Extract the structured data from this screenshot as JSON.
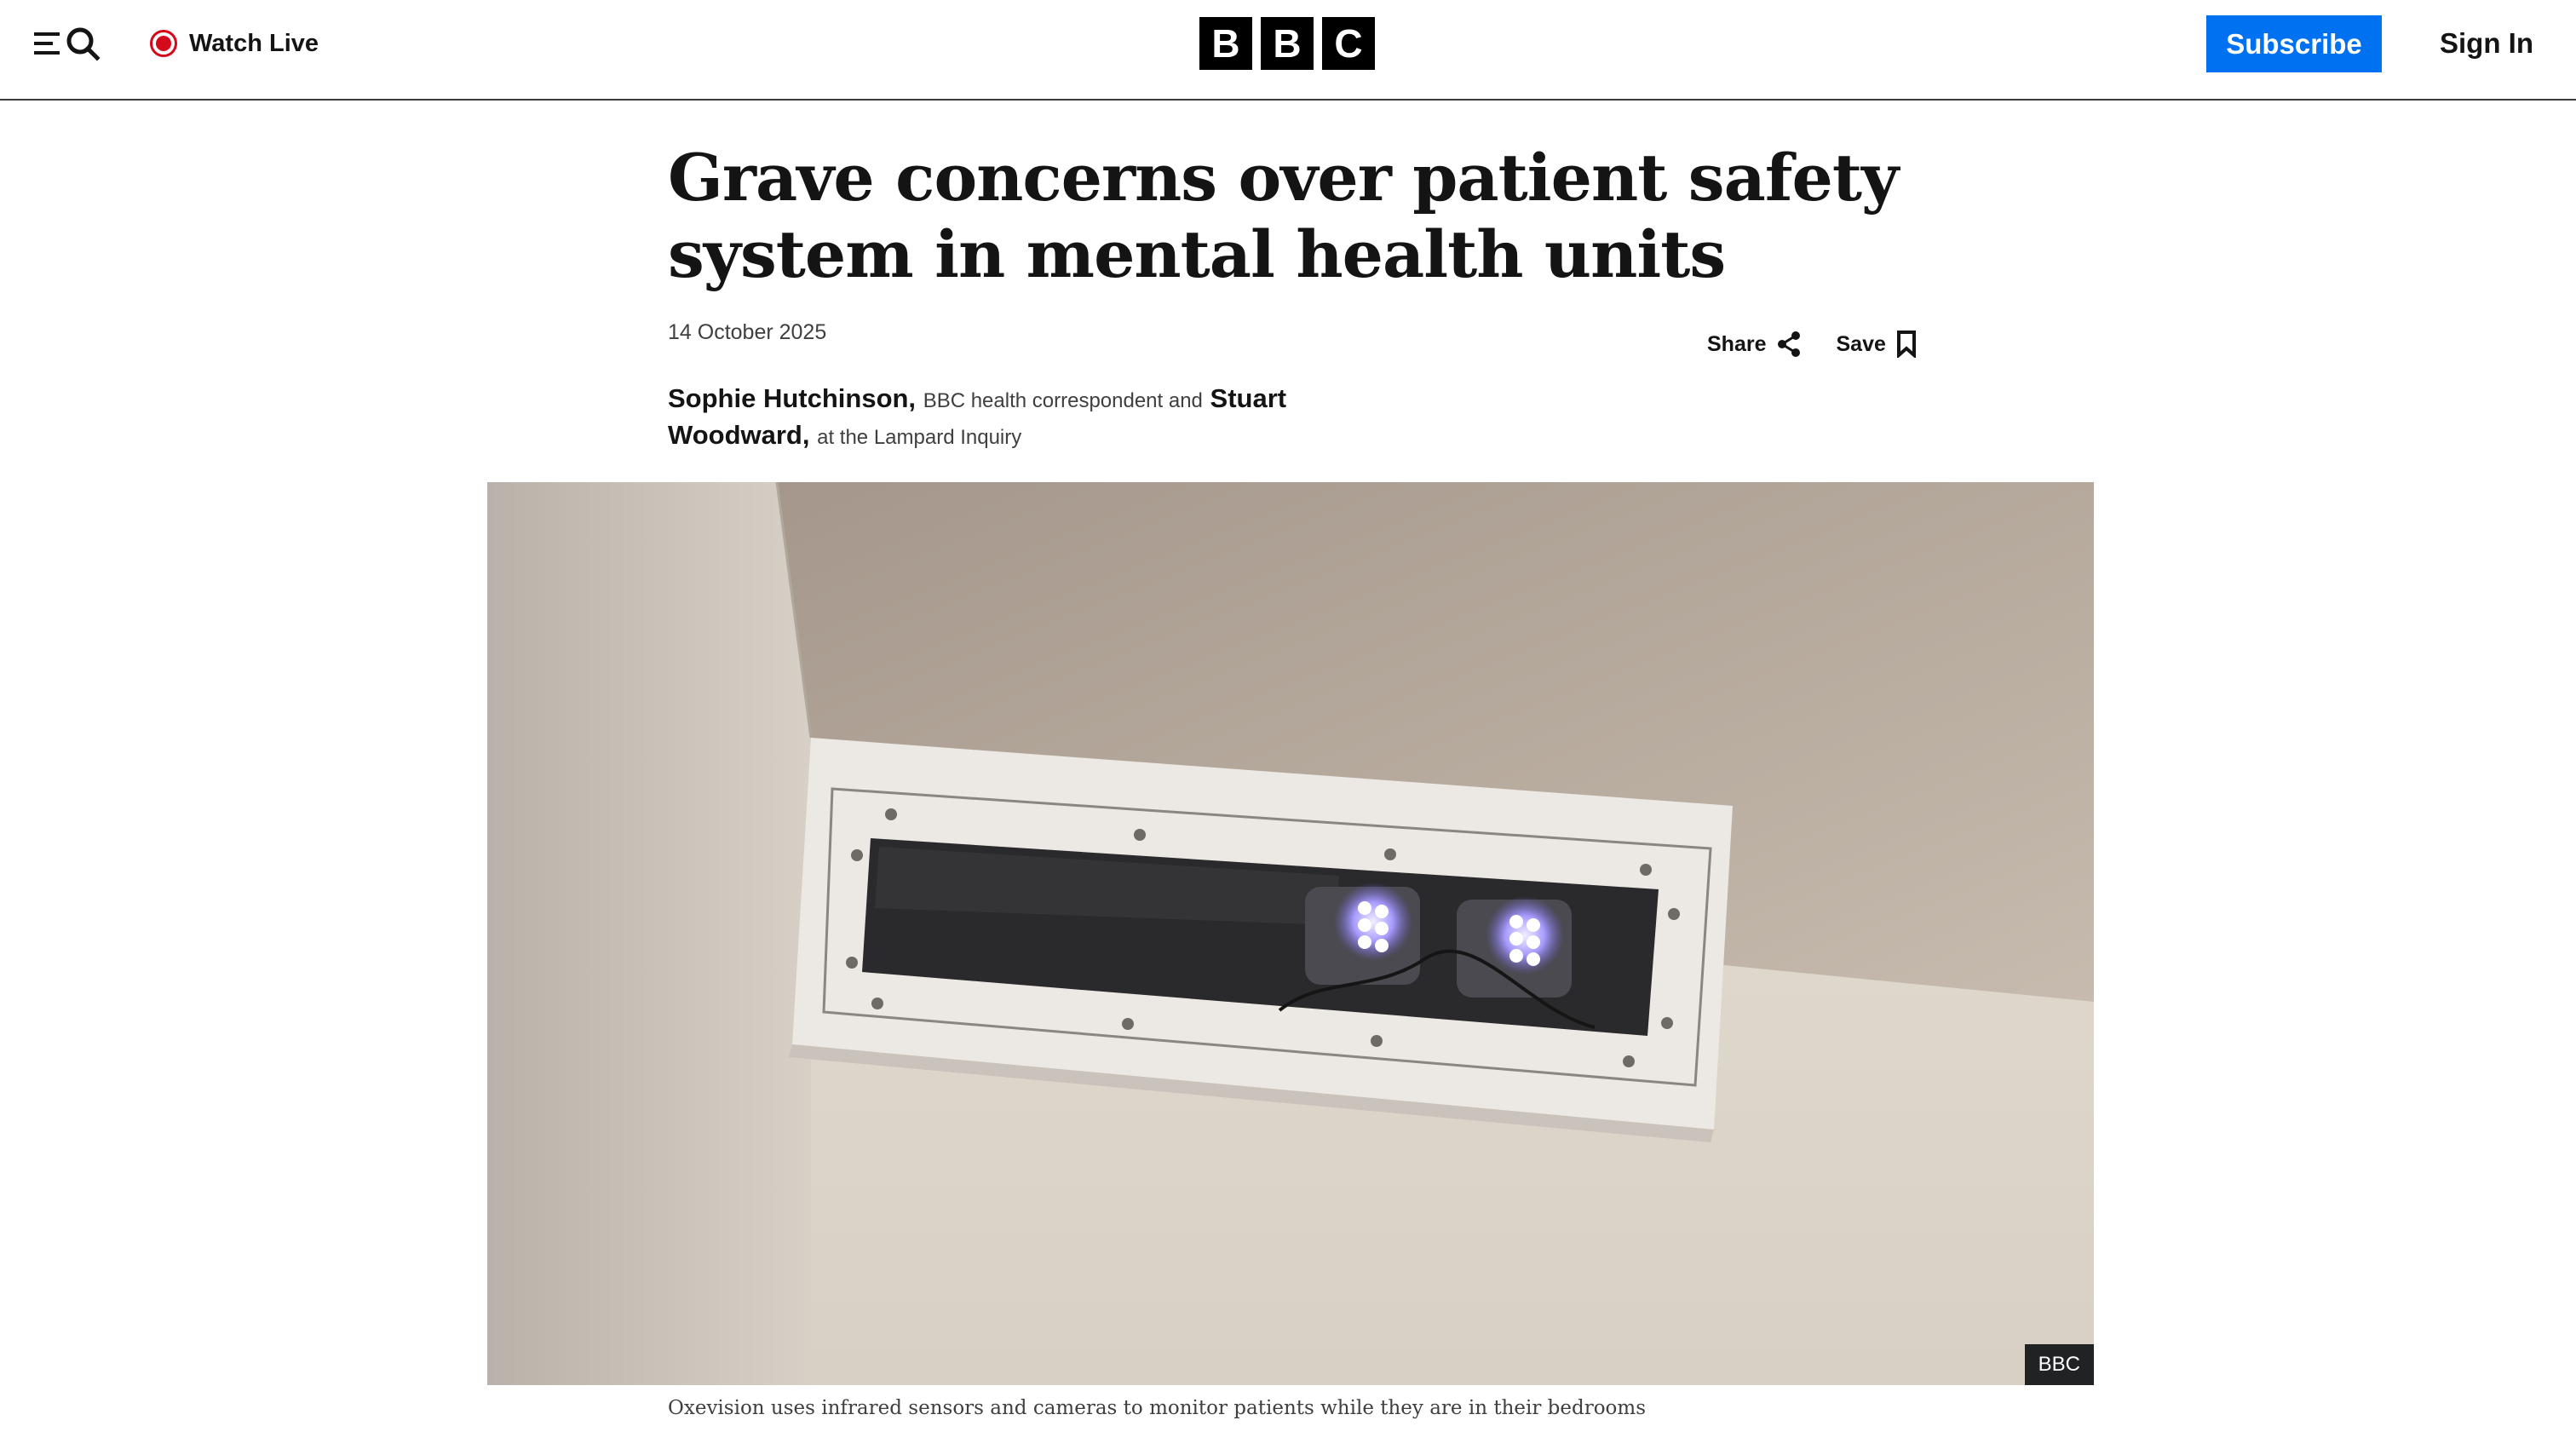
{
  "header": {
    "menu_icon": "menu-icon",
    "search_icon": "search-icon",
    "watch_live_label": "Watch Live",
    "logo_letters": [
      "B",
      "B",
      "C"
    ],
    "subscribe_label": "Subscribe",
    "sign_in_label": "Sign In",
    "colors": {
      "subscribe_bg": "#0071f1",
      "live_red": "#d4091a"
    }
  },
  "article": {
    "headline": "Grave concerns over patient safety system in mental health units",
    "date": "14 October 2025",
    "share_label": "Share",
    "save_label": "Save",
    "authors": [
      {
        "name": "Sophie Hutchinson,",
        "role": "BBC health correspondent and"
      },
      {
        "name": "Stuart Woodward,",
        "role": "at the Lampard Inquiry"
      }
    ],
    "image": {
      "credit": "BBC",
      "caption": "Oxevision uses infrared sensors and cameras to monitor patients while they are in their bedrooms"
    }
  }
}
